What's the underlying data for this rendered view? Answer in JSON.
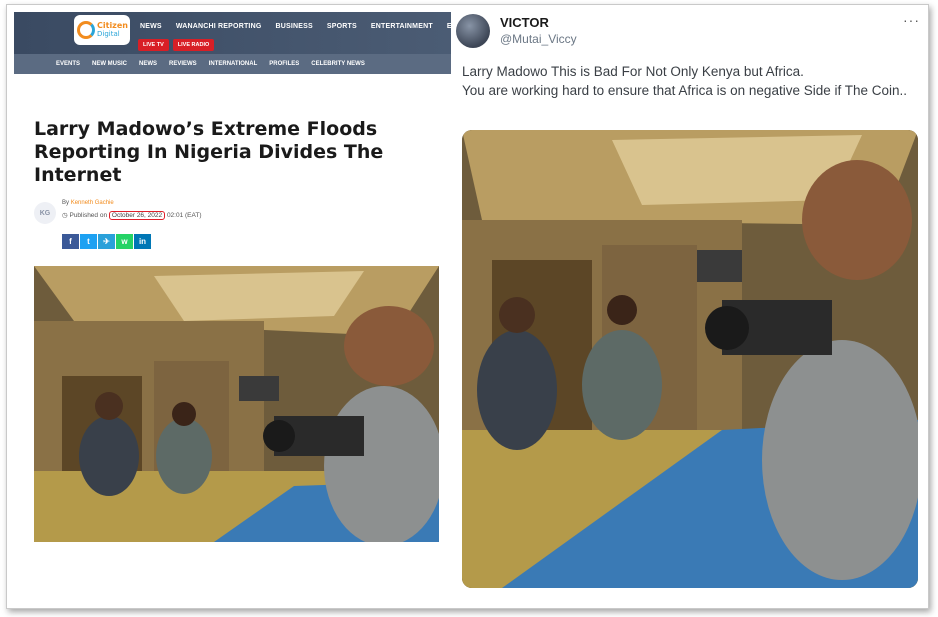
{
  "article": {
    "logo": {
      "brand": "Citizen",
      "sub": "Digital"
    },
    "nav_main": [
      "NEWS",
      "WANANCHI REPORTING",
      "BUSINESS",
      "SPORTS",
      "ENTERTAINMENT",
      "EXCLUSIV"
    ],
    "live_buttons": [
      "LIVE TV",
      "LIVE RADIO"
    ],
    "nav_sub": [
      "EVENTS",
      "NEW MUSIC",
      "NEWS",
      "REVIEWS",
      "INTERNATIONAL",
      "PROFILES",
      "CELEBRITY NEWS"
    ],
    "headline": "Larry Madowo’s Extreme Floods Reporting In Nigeria Divides The Internet",
    "author_initials": "KG",
    "by_label": "By",
    "author": "Kenneth Gachie",
    "published_label": "Published on",
    "published_date": "October 26, 2022",
    "published_time": "02:01 (EAT)",
    "share_buttons": [
      "f",
      "t",
      "✈",
      "w",
      "in"
    ],
    "colors": {
      "brand_orange": "#f28c1e",
      "brand_blue": "#2aa5d8",
      "live_red": "#d81f26",
      "highlight_circle": "#e0202a"
    }
  },
  "tweet": {
    "name": "VICTOR",
    "handle": "@Mutai_Viccy",
    "more_icon": "more-dots-icon",
    "more_glyph": "···",
    "text": "Larry Madowo This is Bad For Not Only Kenya but Africa.\nYou are working hard to ensure that Africa is on negative Side if The Coin.."
  }
}
